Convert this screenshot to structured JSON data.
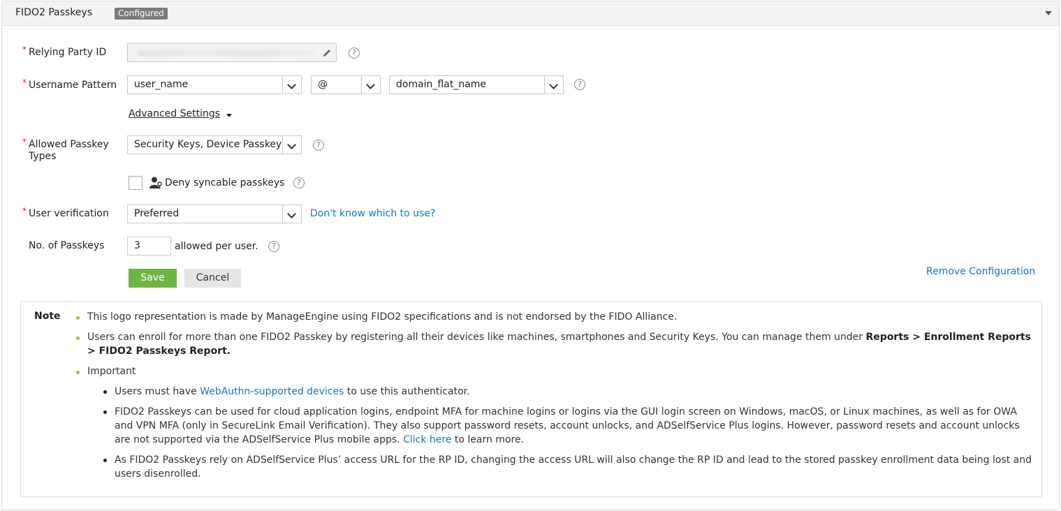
{
  "header": {
    "title": "FIDO2 Passkeys",
    "badge": "Configured"
  },
  "form": {
    "relying_party": {
      "label": "Relying Party ID",
      "required": "*"
    },
    "username_pattern": {
      "label": "Username Pattern",
      "required": "*",
      "part1": "user_name",
      "separator": "@",
      "part2": "domain_flat_name"
    },
    "advanced_settings": "Advanced Settings",
    "allowed_types": {
      "label_line1": "Allowed Passkey",
      "label_line2": "Types",
      "required": "*",
      "value": "Security Keys, Device Passkeys"
    },
    "deny_syncable": {
      "label": "Deny syncable passkeys"
    },
    "user_verification": {
      "label": "User verification",
      "required": "*",
      "value": "Preferred",
      "help_link": "Don't know which to use?"
    },
    "num_passkeys": {
      "label": "No. of Passkeys",
      "value": "3",
      "suffix": "allowed per user."
    },
    "help_glyph": "?"
  },
  "actions": {
    "save": "Save",
    "cancel": "Cancel",
    "remove": "Remove Configuration"
  },
  "note": {
    "title": "Note",
    "items": {
      "i1": "This logo representation is made by ManageEngine using FIDO2 specifications and is not endorsed by the FIDO Alliance.",
      "i2_text": "Users can enroll for more than one FIDO2 Passkey by registering all their devices like machines, smartphones and Security Keys. You can manage them under ",
      "i2_bold": "Reports > Enrollment Reports > FIDO2 Passkeys Report.",
      "i3": "Important"
    },
    "sub": {
      "s1_pre": "Users must have ",
      "s1_link": "WebAuthn-supported devices",
      "s1_post": " to use this authenticator.",
      "s2_pre": "FIDO2 Passkeys can be used for cloud application logins, endpoint MFA for machine logins or logins via the GUI login screen on Windows, macOS, or Linux machines, as well as for OWA and VPN MFA (only in SecureLink Email Verification). They also support password resets, account unlocks, and ADSelfService Plus logins. However, password resets and account unlocks are not supported via the ADSelfService Plus mobile apps. ",
      "s2_link": "Click here",
      "s2_post": " to learn more.",
      "s3": "As FIDO2 Passkeys rely on ADSelfService Plus’ access URL for the RP ID, changing the access URL will also change the RP ID and lead to the stored passkey enrollment data being lost and users disenrolled."
    }
  }
}
